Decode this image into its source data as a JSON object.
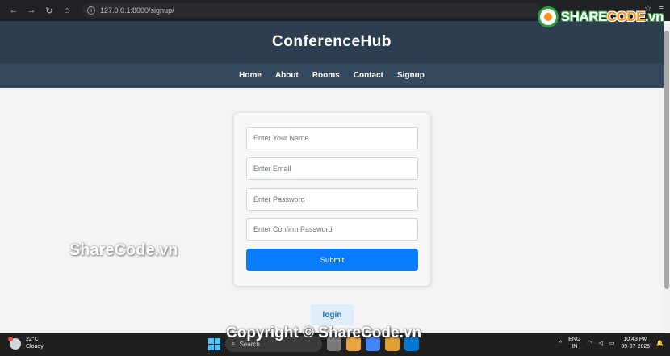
{
  "browser": {
    "url": "127.0.0.1:8000/signup/"
  },
  "watermark": {
    "logo_text_a": "SHARE",
    "logo_text_b": "CODE",
    "logo_text_c": ".vn",
    "center_text": "ShareCode.vn",
    "bottom_text": "Copyright © ShareCode.vn"
  },
  "site": {
    "title": "ConferenceHub",
    "nav": [
      "Home",
      "About",
      "Rooms",
      "Contact",
      "Signup"
    ]
  },
  "signup_form": {
    "name_placeholder": "Enter Your Name",
    "email_placeholder": "Enter Email",
    "password_placeholder": "Enter Password",
    "confirm_placeholder": "Enter Confirm Password",
    "submit_label": "Submit"
  },
  "login_label": "login",
  "taskbar": {
    "temperature": "22°C",
    "weather": "Cloudy",
    "search": "Search",
    "lang_top": "ENG",
    "lang_bottom": "IN",
    "time": "10:43 PM",
    "date": "09-07-2025"
  },
  "colors": {
    "header": "#2c3e50",
    "nav": "#34495e",
    "submit": "#0a7cff",
    "login_bg": "#ddeefa"
  }
}
